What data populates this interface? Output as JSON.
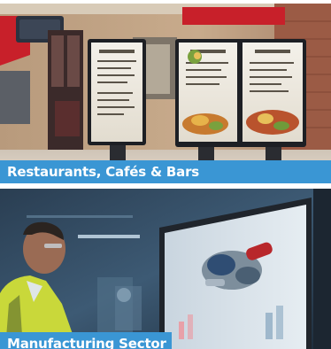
{
  "tiles": [
    {
      "caption": "Restaurants, Cafés & Bars",
      "caption_bg": "#3a96d4"
    },
    {
      "caption": "Manufacturing Sector",
      "caption_bg": "#3a96d4"
    }
  ],
  "colors": {
    "accent": "#3a96d4",
    "awning_red": "#c8202a"
  }
}
